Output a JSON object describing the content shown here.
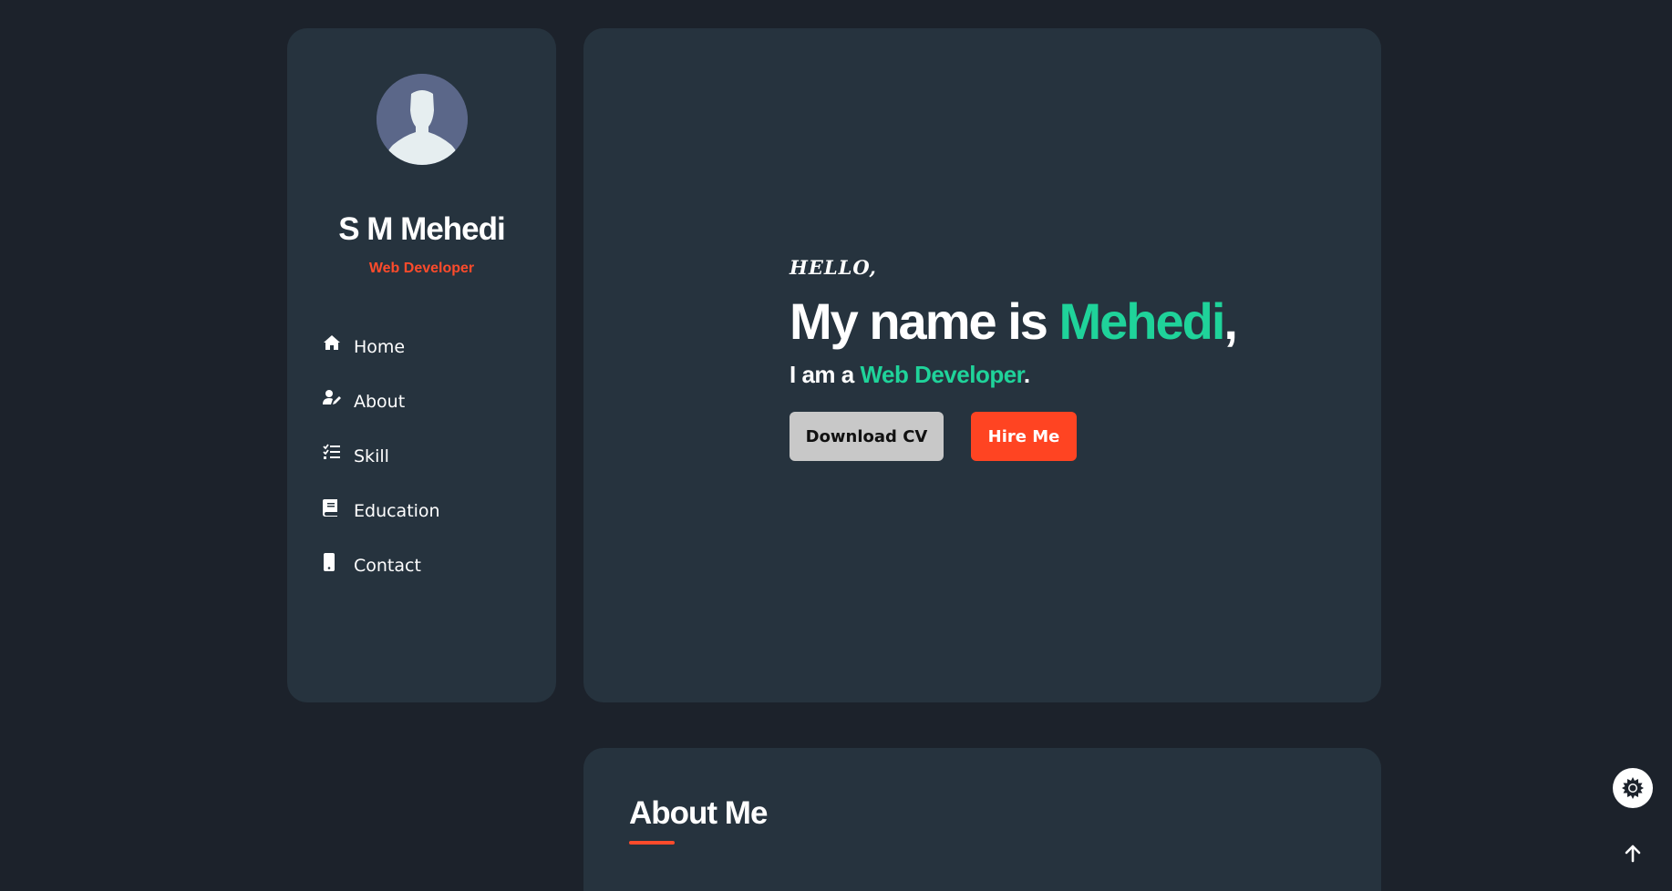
{
  "sidebar": {
    "name": "S M Mehedi",
    "role": "Web Developer",
    "avatar_icon": "person-silhouette-icon",
    "nav": [
      {
        "label": "Home",
        "icon": "home-icon"
      },
      {
        "label": "About",
        "icon": "user-edit-icon"
      },
      {
        "label": "Skill",
        "icon": "checklist-icon"
      },
      {
        "label": "Education",
        "icon": "book-icon"
      },
      {
        "label": "Contact",
        "icon": "phone-icon"
      }
    ]
  },
  "hero": {
    "greeting": "HELLO,",
    "headline_prefix": "My name is ",
    "headline_name": "Mehedi",
    "headline_suffix": ",",
    "subline_prefix": "I am a ",
    "subline_role": "Web Developer",
    "subline_suffix": ".",
    "download_cv_label": "Download CV",
    "hire_me_label": "Hire Me"
  },
  "about": {
    "title": "About Me"
  },
  "floating": {
    "theme_toggle_icon": "sun-gear-icon",
    "scroll_top_icon": "arrow-up-icon"
  },
  "colors": {
    "background": "#1c222b",
    "card": "#26333e",
    "accent_green": "#1fd39a",
    "accent_red": "#ff4b2b",
    "button_grey": "#c8c8c8"
  }
}
